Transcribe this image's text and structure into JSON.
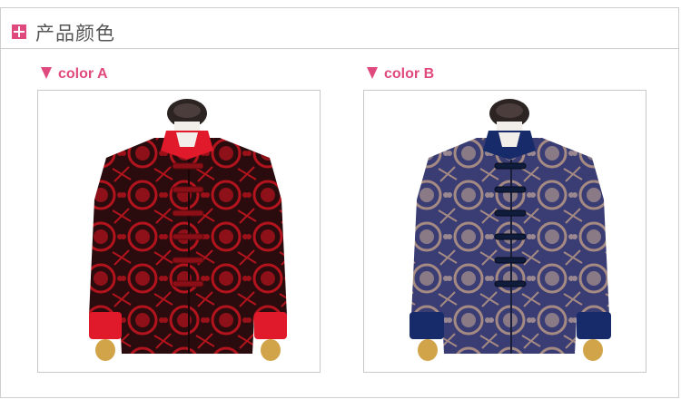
{
  "section": {
    "title": "产品颜色",
    "icon": "plus-square-icon",
    "accent_color": "#e0497e"
  },
  "variants": [
    {
      "label": "color A",
      "icon": "down-triangle-icon",
      "jacket_colors": {
        "base": "#2a0c0e",
        "pattern": "#b2131c",
        "trim": "#e01a2b",
        "buttons": "#8a0f16"
      }
    },
    {
      "label": "color B",
      "icon": "down-triangle-icon",
      "jacket_colors": {
        "base": "#3a3c74",
        "pattern": "#a48a82",
        "trim": "#172a6a",
        "buttons": "#101c3c"
      }
    }
  ]
}
